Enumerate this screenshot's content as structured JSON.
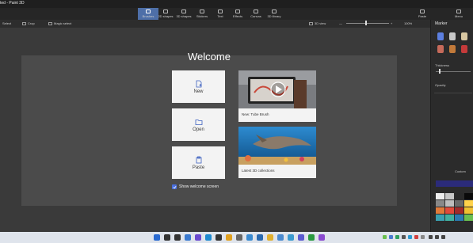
{
  "app": {
    "title": "ted - Paint 3D"
  },
  "toolbar": {
    "tools": [
      "Brushes",
      "2D shapes",
      "3D shapes",
      "Stickers",
      "Text",
      "Effects",
      "Canvas",
      "3D library"
    ],
    "right_tools": [
      "Paste",
      "Menu"
    ]
  },
  "subtoolbar": {
    "select": "Select",
    "crop": "Crop",
    "magic_select": "Magic select",
    "view": "3D view",
    "zoom": "100%"
  },
  "sidepanel": {
    "title": "Marker",
    "thickness_label": "Thickness",
    "opacity_label": "Opacity",
    "custom_label": "Custom",
    "add_color": "+ Add color",
    "brush_colors": [
      "#5c7fe0",
      "#c9c9c9",
      "#d8c7a2",
      "#c66a5a",
      "#c27a3a",
      "#c43a3a"
    ],
    "palette": [
      "#eeeeee",
      "#c8c8c8",
      "#2a2a2a",
      "#0a0a0a",
      "#888888",
      "#bdbdbd",
      "#6a6a6a",
      "#ffd24a",
      "#e07a3a",
      "#e04a3a",
      "#a02a2a",
      "#f0c030",
      "#3aa0b0",
      "#40b0a0",
      "#2a7ab0",
      "#6abf50"
    ]
  },
  "welcome": {
    "title": "Welcome",
    "new_label": "New",
    "open_label": "Open",
    "paste_label": "Paste",
    "card1_caption": "New: Tube Brush",
    "card2_caption": "Latest 3D collections",
    "show_welcome_label": "Show welcome screen",
    "show_welcome_checked": true
  },
  "taskbar": {
    "icons": [
      "windows-start",
      "search",
      "task-view",
      "widgets",
      "chat",
      "edge",
      "store",
      "chrome",
      "settings",
      "paint",
      "mail",
      "file-explorer",
      "notepad",
      "photos",
      "teams",
      "xbox",
      "paint-3d"
    ]
  }
}
